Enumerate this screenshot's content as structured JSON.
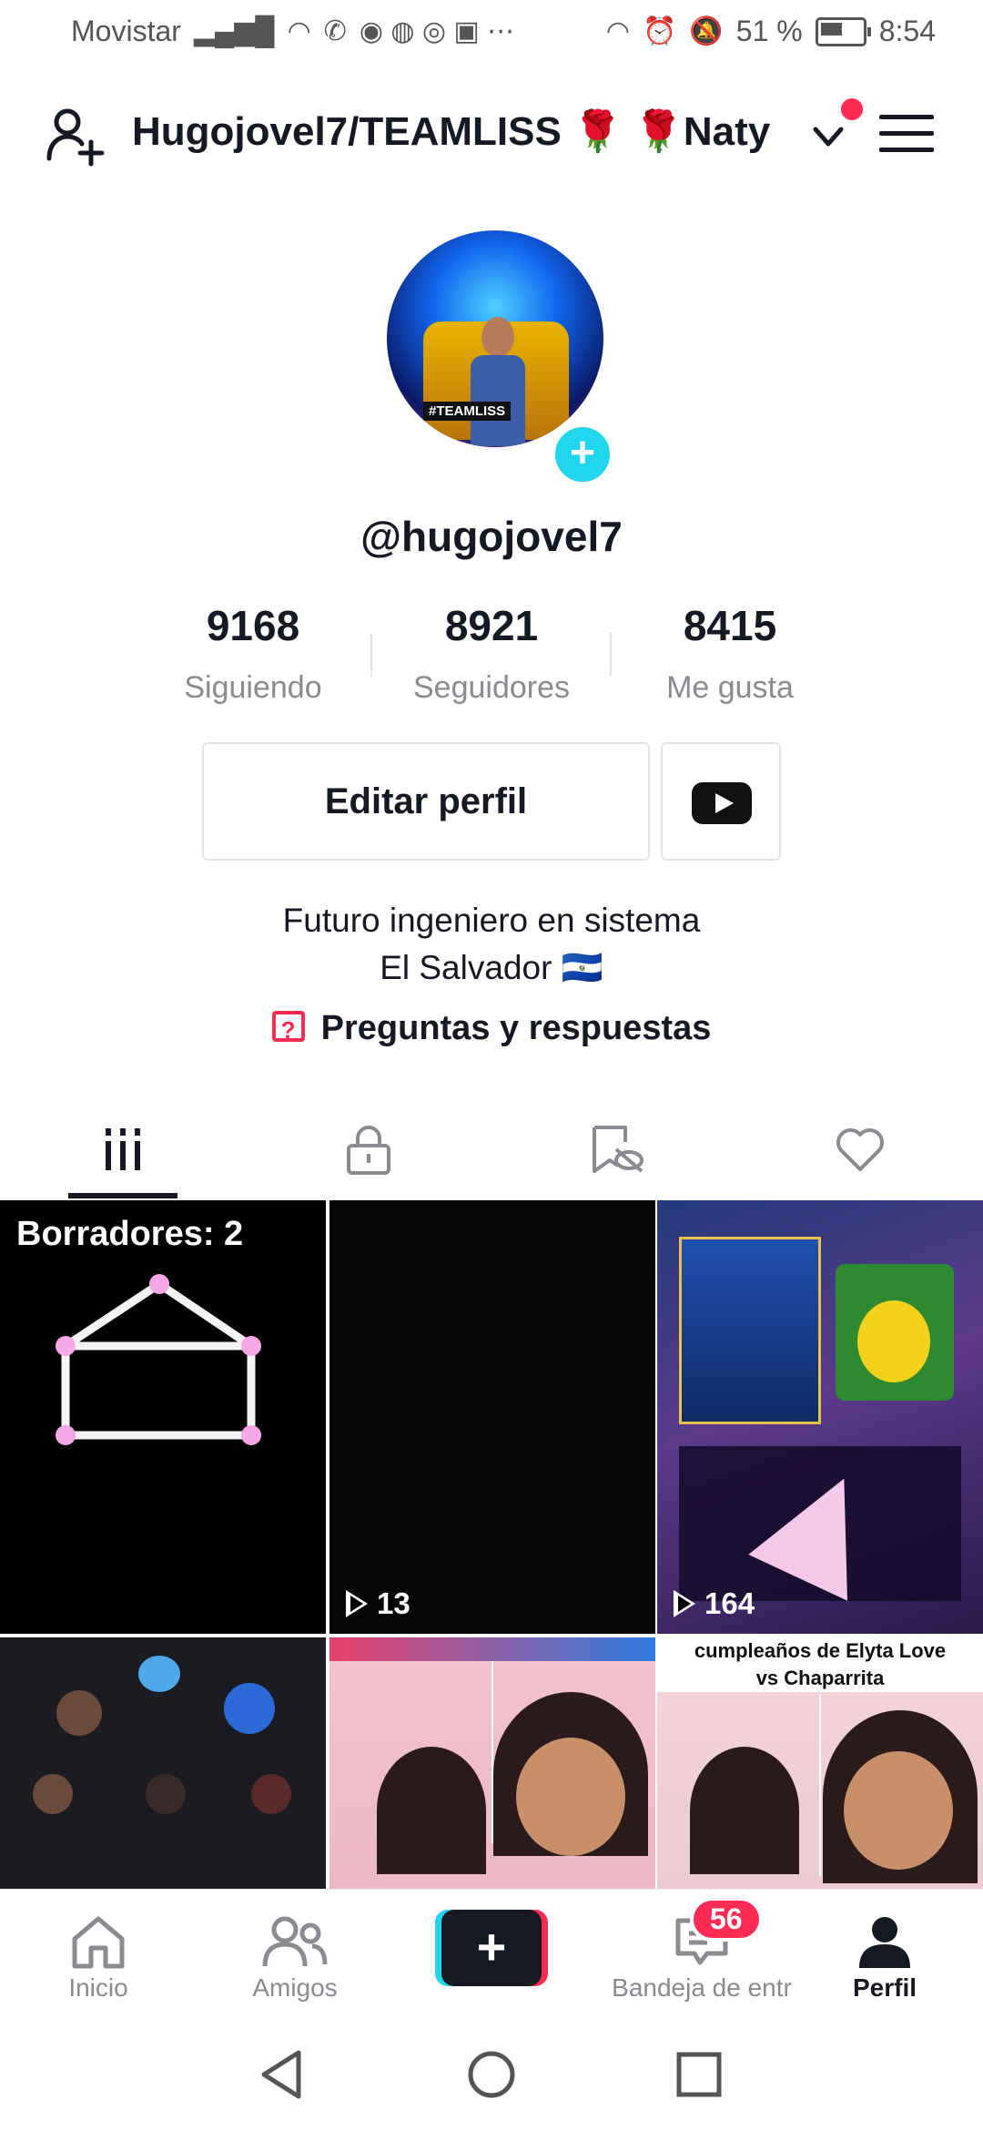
{
  "status_bar": {
    "carrier": "Movistar",
    "battery_percent": "51 %",
    "time": "8:54"
  },
  "header": {
    "title": "Hugojovel7/TEAMLISS",
    "rose": "🌹",
    "account_name": "Naty"
  },
  "profile": {
    "avatar_tag": "#TEAMLISS",
    "username": "@hugojovel7",
    "stats": [
      {
        "value": "9168",
        "label": "Siguiendo"
      },
      {
        "value": "8921",
        "label": "Seguidores"
      },
      {
        "value": "8415",
        "label": "Me gusta"
      }
    ],
    "edit_button": "Editar perfil",
    "bio_line1": "Futuro ingeniero en sistema",
    "bio_line2": "El Salvador",
    "flag": "🇸🇻",
    "qa_label": "Preguntas y respuestas"
  },
  "grid": {
    "drafts_label": "Borradores: 2",
    "items": [
      {
        "views": "13"
      },
      {
        "views": "164"
      }
    ],
    "caption_line1": "cumpleaños de Elyta Love",
    "caption_line2": "vs Chaparrita"
  },
  "bottom_nav": {
    "home": "Inicio",
    "friends": "Amigos",
    "inbox": "Bandeja de entr",
    "inbox_badge": "56",
    "profile": "Perfil"
  },
  "colors": {
    "accent": "#fe2c55",
    "cyan": "#20d5ec",
    "text": "#161823",
    "muted": "#8a8b91"
  }
}
